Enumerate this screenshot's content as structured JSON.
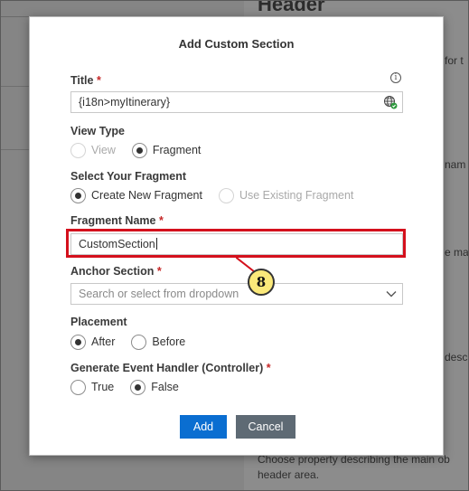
{
  "background": {
    "heading": "Header",
    "snippets": [
      "for t",
      "nam",
      "e ma",
      "descr"
    ],
    "footer_text_1": "Choose property describing the main ob",
    "footer_text_2": "header area."
  },
  "dialog": {
    "title": "Add Custom Section",
    "title_field": {
      "label": "Title",
      "required": "*",
      "value": "{i18n>myItinerary}",
      "info_icon": "info-icon",
      "trailing_icon": "globe-icon"
    },
    "view_type": {
      "label": "View Type",
      "options": [
        {
          "label": "View",
          "checked": false,
          "disabled": true
        },
        {
          "label": "Fragment",
          "checked": true,
          "disabled": false
        }
      ]
    },
    "select_fragment": {
      "label": "Select Your Fragment",
      "options": [
        {
          "label": "Create New Fragment",
          "checked": true,
          "disabled": false
        },
        {
          "label": "Use Existing Fragment",
          "checked": false,
          "disabled": true
        }
      ]
    },
    "fragment_name": {
      "label": "Fragment Name",
      "required": "*",
      "value": "CustomSection"
    },
    "anchor_section": {
      "label": "Anchor Section",
      "required": "*",
      "placeholder": "Search or select from dropdown"
    },
    "placement": {
      "label": "Placement",
      "options": [
        {
          "label": "After",
          "checked": true
        },
        {
          "label": "Before",
          "checked": false
        }
      ]
    },
    "event_handler": {
      "label": "Generate Event Handler (Controller)",
      "required": "*",
      "options": [
        {
          "label": "True",
          "checked": false
        },
        {
          "label": "False",
          "checked": true
        }
      ]
    },
    "buttons": {
      "add": "Add",
      "cancel": "Cancel"
    }
  },
  "annotation": {
    "step_number": "8",
    "highlight_color": "#d4101c",
    "badge_color": "#fbe97a"
  },
  "colors": {
    "primary_button": "#0a6ed1",
    "secondary_button": "#5e6a74",
    "required": "#c62828"
  }
}
